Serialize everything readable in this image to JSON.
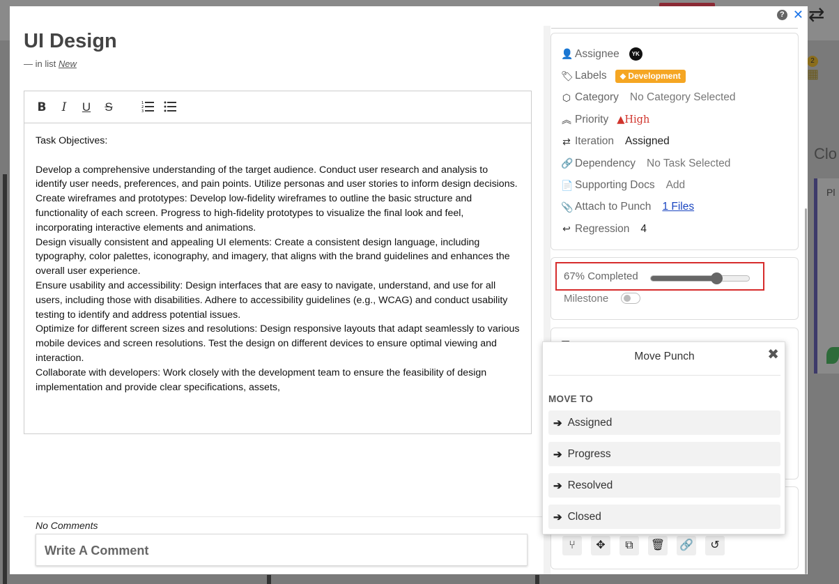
{
  "background": {
    "badge_count": "2",
    "clo_text": "Clo",
    "pl_text": "Pl"
  },
  "task": {
    "title": "UI Design",
    "in_list_prefix": "— in list",
    "list_name": "New"
  },
  "editor": {
    "paragraphs": [
      "Task Objectives:",
      "",
      "Develop a comprehensive understanding of the target audience. Conduct user research and analysis to identify user needs, preferences, and pain points. Utilize personas and user stories to inform design decisions.",
      "Create wireframes and prototypes: Develop low-fidelity wireframes to outline the basic structure and functionality of each screen. Progress to high-fidelity prototypes to visualize the final look and feel, incorporating interactive elements and animations.",
      "Design visually consistent and appealing UI elements: Create a consistent design language, including typography, color palettes, iconography, and imagery, that aligns with the brand guidelines and enhances the overall user experience.",
      "Ensure usability and accessibility: Design interfaces that are easy to navigate, understand, and use for all users, including those with disabilities. Adhere to accessibility guidelines (e.g., WCAG) and conduct usability testing to identify and address potential issues.",
      "Optimize for different screen sizes and resolutions: Design responsive layouts that adapt seamlessly to various mobile devices and screen resolutions. Test the design on different devices to ensure optimal viewing and interaction.",
      "Collaborate with developers: Work closely with the development team to ensure the feasibility of design implementation and provide clear specifications, assets,"
    ]
  },
  "comments": {
    "empty_text": "No Comments",
    "placeholder": "Write A Comment"
  },
  "properties": {
    "assignee_label": "Assignee",
    "assignee_initials": "YK",
    "labels_label": "Labels",
    "label_value": "Development",
    "category_label": "Category",
    "category_value": "No Category Selected",
    "priority_label": "Priority",
    "priority_value": "High",
    "iteration_label": "Iteration",
    "iteration_value": "Assigned",
    "dependency_label": "Dependency",
    "dependency_value": "No Task Selected",
    "docs_label": "Supporting Docs",
    "docs_value": "Add",
    "attach_label": "Attach to Punch",
    "attach_value": "1 Files",
    "regression_label": "Regression",
    "regression_value": "4"
  },
  "progress": {
    "label": "67% Completed",
    "percent": 67,
    "milestone_label": "Milestone",
    "milestone_on": false
  },
  "move_punch": {
    "title": "Move Punch",
    "section_label": "MOVE TO",
    "options": [
      "Assigned",
      "Progress",
      "Resolved",
      "Closed"
    ]
  },
  "colors": {
    "label_badge": "#f5a623",
    "priority_high": "#d0342c",
    "highlight_border": "#d62b2b",
    "link": "#1a45c0"
  }
}
